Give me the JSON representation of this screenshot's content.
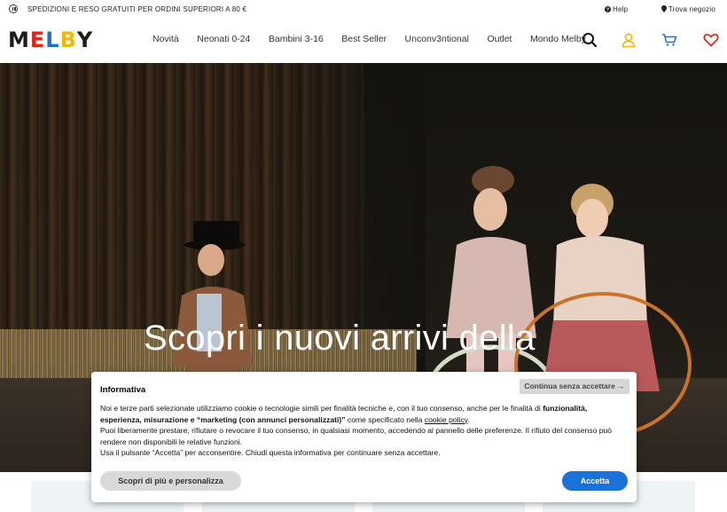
{
  "topbar": {
    "promo": "SPEDIZIONI E RESO GRATUITI PER ORDINI SUPERIORI A 80 €",
    "help": "Help",
    "store": "Trova negozio"
  },
  "brand": {
    "letters": [
      "M",
      "E",
      "L",
      "B",
      "Y"
    ],
    "colors": [
      "#1c1c1c",
      "#e2231a",
      "#1d6fd1",
      "#f2b705",
      "#1c1c1c"
    ]
  },
  "nav": [
    "Novità",
    "Neonati 0-24",
    "Bambini 3-16",
    "Best Seller",
    "Unconv3ntional",
    "Outlet",
    "Mondo Melby"
  ],
  "header_icons": [
    "search-icon",
    "user-icon",
    "cart-icon",
    "heart-icon"
  ],
  "accent_colors": {
    "user": "#f2b705",
    "cart": "#1d6fd1",
    "heart": "#e2231a"
  },
  "hero": {
    "title": "Scopri i nuovi arrivi della"
  },
  "cookie": {
    "title": "Informativa",
    "continue": "Continua senza accettare →",
    "p1_a": "Noi e terze parti selezionate utilizziamo cookie o tecnologie simili per finalità tecniche e, con il tuo consenso, anche per le finalità di ",
    "p1_b": "funzionalità, esperienza, misurazione e “marketing (con annunci personalizzati)”",
    "p1_c": " come specificato nella ",
    "p1_link": "cookie policy",
    "p1_d": ".",
    "p2": "Puoi liberamente prestare, rifiutare o revocare il tuo consenso, in qualsiasi momento, accedendo al pannello delle preferenze. Il rifiuto del consenso può rendere non disponibili le relative funzioni.",
    "p3": "Usa il pulsante “Accetta” per acconsentire. Chiudi questa informativa per continuare senza accettare.",
    "more": "Scopri di più e personalizza",
    "accept": "Accetta"
  }
}
